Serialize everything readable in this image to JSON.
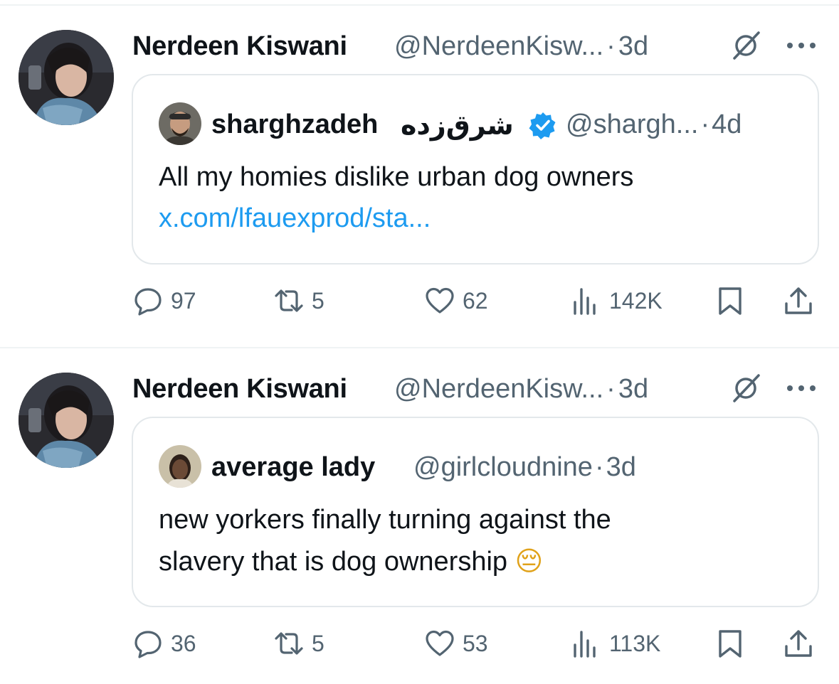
{
  "tweets": [
    {
      "author_name": "Nerdeen Kiswani",
      "author_handle": "@NerdeenKisw...",
      "separator": "·",
      "time": "3d",
      "quote": {
        "name": "sharghzadeh",
        "name_rtl": "شرق‌زده",
        "verified": true,
        "handle": "@shargh...",
        "separator": "·",
        "time": "4d",
        "text_lines": [
          "All my homies dislike urban dog owners"
        ],
        "link": "x.com/lfauexprod/sta..."
      },
      "stats": {
        "replies": "97",
        "reposts": "5",
        "likes": "62",
        "views": "142K"
      }
    },
    {
      "author_name": "Nerdeen Kiswani",
      "author_handle": "@NerdeenKisw...",
      "separator": "·",
      "time": "3d",
      "quote": {
        "name": "average lady",
        "handle": "@girlcloudnine",
        "separator": "·",
        "time": "3d",
        "text_lines": [
          "new yorkers finally turning against the",
          "slavery that is dog ownership"
        ],
        "emoji": "😔"
      },
      "stats": {
        "replies": "36",
        "reposts": "5",
        "likes": "53",
        "views": "113K"
      }
    }
  ],
  "icons": {
    "reply": "reply-icon",
    "repost": "repost-icon",
    "like": "heart-icon",
    "views": "views-icon",
    "bookmark": "bookmark-icon",
    "share": "share-icon",
    "grok": "grok-icon",
    "more": "more-icon",
    "verified": "verified-badge-icon"
  },
  "colors": {
    "text": "#0f1419",
    "secondary": "#536471",
    "link": "#1d9bf0",
    "verified": "#1d9bf0",
    "border": "#e3e8eb"
  }
}
